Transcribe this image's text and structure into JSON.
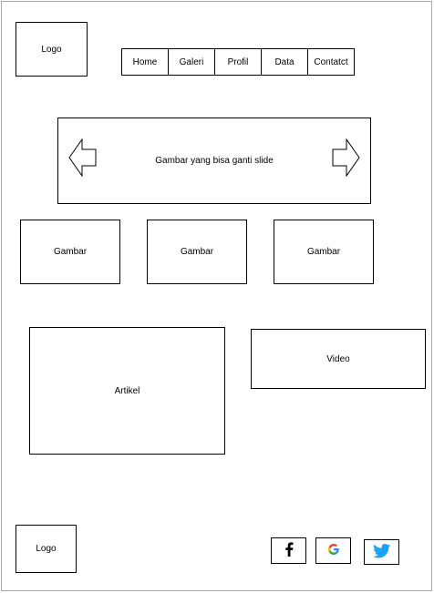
{
  "header": {
    "logo_label": "Logo",
    "nav": [
      {
        "label": "Home"
      },
      {
        "label": "Galeri"
      },
      {
        "label": "Profil"
      },
      {
        "label": "Data"
      },
      {
        "label": "Contatct"
      }
    ]
  },
  "slider": {
    "caption": "Gambar yang bisa ganti slide",
    "prev_icon": "arrow-left-icon",
    "next_icon": "arrow-right-icon"
  },
  "gallery": [
    {
      "label": "Gambar"
    },
    {
      "label": "Gambar"
    },
    {
      "label": "Gambar"
    }
  ],
  "content": {
    "article_label": "Artikel",
    "video_label": "Video"
  },
  "footer": {
    "logo_label": "Logo",
    "social": [
      {
        "icon": "facebook-icon",
        "color": "#000000"
      },
      {
        "icon": "google-icon",
        "color": "#4285F4"
      },
      {
        "icon": "twitter-icon",
        "color": "#1DA1F2"
      }
    ]
  }
}
